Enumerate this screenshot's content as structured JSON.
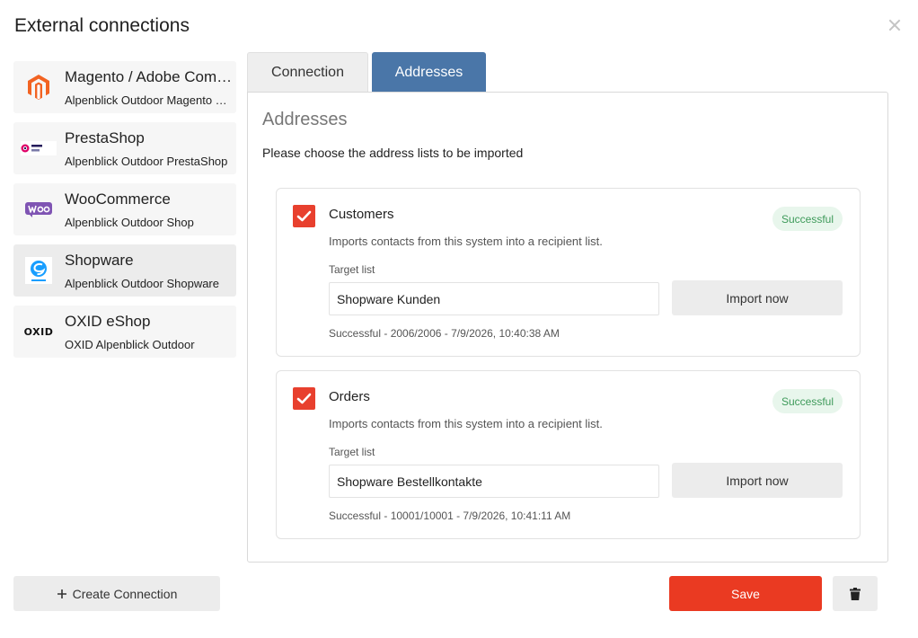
{
  "dialog": {
    "title": "External connections"
  },
  "sidebar": {
    "items": [
      {
        "name": "Magento / Adobe Commerce",
        "sub": "Alpenblick Outdoor Magento Shop",
        "icon": "magento-logo-icon",
        "active": false
      },
      {
        "name": "PrestaShop",
        "sub": "Alpenblick Outdoor PrestaShop",
        "icon": "prestashop-logo-icon",
        "active": false
      },
      {
        "name": "WooCommerce",
        "sub": "Alpenblick Outdoor Shop",
        "icon": "woocommerce-logo-icon",
        "active": false
      },
      {
        "name": "Shopware",
        "sub": "Alpenblick Outdoor Shopware",
        "icon": "shopware-logo-icon",
        "active": true
      },
      {
        "name": "OXID eShop",
        "sub": "OXID Alpenblick Outdoor",
        "icon": "oxid-logo-icon",
        "active": false
      }
    ],
    "logo_texts": {
      "woo": "Woo",
      "oxid": "OXID",
      "presta": "Presta Shop"
    }
  },
  "tabs": {
    "connection": "Connection",
    "addresses": "Addresses",
    "active": "addresses"
  },
  "panel": {
    "title": "Addresses",
    "description": "Please choose the address lists to be imported",
    "cards": [
      {
        "name": "Customers",
        "checked": true,
        "badge": "Successful",
        "description": "Imports contacts from this system into a recipient list.",
        "target_label": "Target list",
        "target_value": "Shopware Kunden",
        "import_label": "Import now",
        "status": "Successful - 2006/2006 - 7/9/2026, 10:40:38 AM"
      },
      {
        "name": "Orders",
        "checked": true,
        "badge": "Successful",
        "description": "Imports contacts from this system into a recipient list.",
        "target_label": "Target list",
        "target_value": "Shopware Bestellkontakte",
        "import_label": "Import now",
        "status": "Successful - 10001/10001 - 7/9/2026, 10:41:11 AM"
      }
    ]
  },
  "footer": {
    "create_label": "Create Connection",
    "save_label": "Save"
  },
  "colors": {
    "accent": "#ea3a22",
    "tab_active": "#4a76a8",
    "success_bg": "#e8f6ec",
    "success_text": "#3e9a5a"
  }
}
